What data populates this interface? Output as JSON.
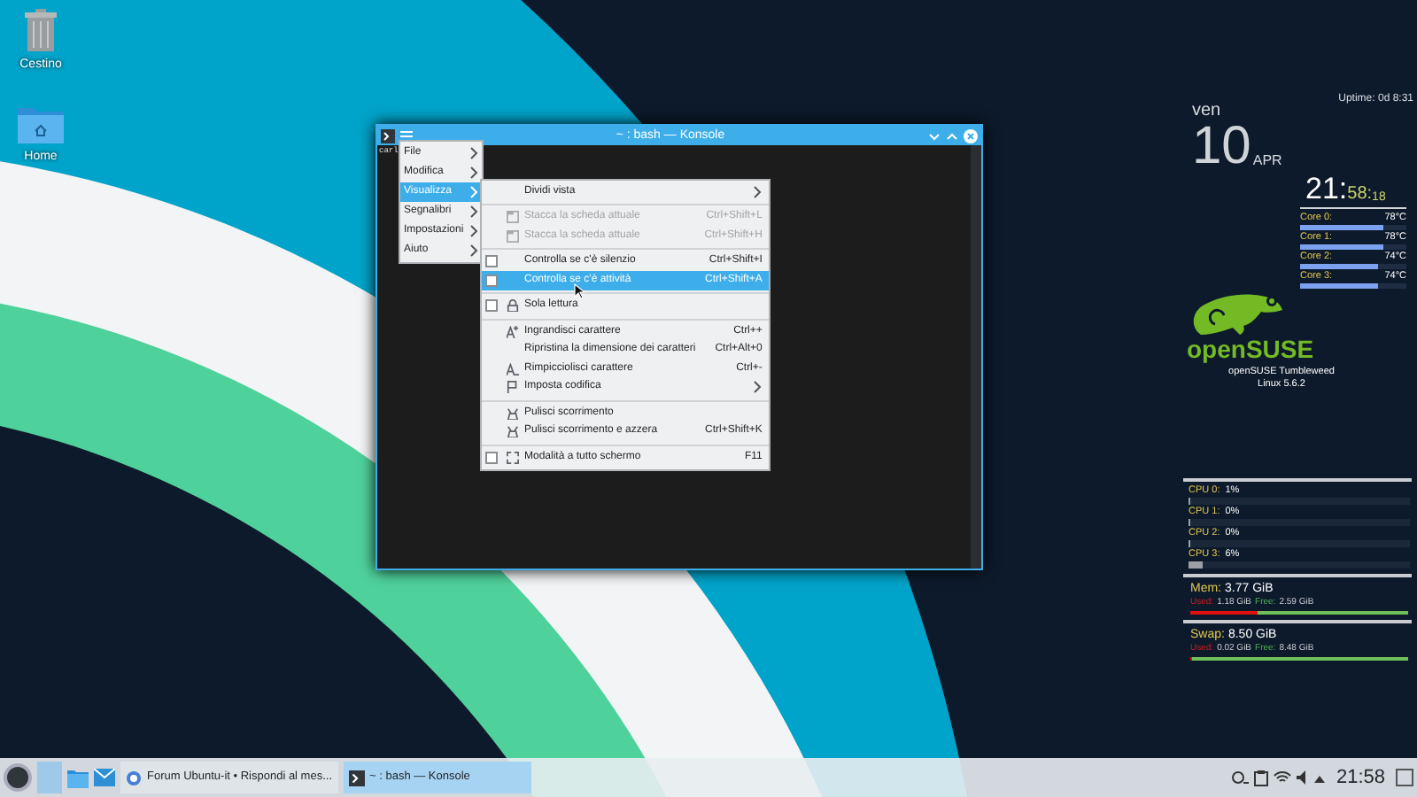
{
  "desktop_icons": [
    {
      "label": "Cestino",
      "kind": "trash"
    },
    {
      "label": "Home",
      "kind": "folder"
    }
  ],
  "konsole": {
    "title": "~ : bash — Konsole",
    "terminal_text": "carl",
    "menu": [
      {
        "label": "File",
        "selected": false
      },
      {
        "label": "Modifica",
        "selected": false
      },
      {
        "label": "Visualizza",
        "selected": true
      },
      {
        "label": "Segnalibri",
        "selected": false
      },
      {
        "label": "Impostazioni",
        "selected": false
      },
      {
        "label": "Aiuto",
        "selected": false
      }
    ],
    "submenu": [
      {
        "kind": "item",
        "label": "Dividi vista",
        "has_submenu": true,
        "disabled": false,
        "selected": false
      },
      {
        "kind": "separator"
      },
      {
        "kind": "item",
        "label": "Stacca la scheda attuale",
        "shortcut": "Ctrl+Shift+L",
        "disabled": true,
        "selected": false
      },
      {
        "kind": "item",
        "label": "Stacca la scheda attuale",
        "shortcut": "Ctrl+Shift+H",
        "disabled": true,
        "selected": false
      },
      {
        "kind": "separator"
      },
      {
        "kind": "check",
        "label": "Controlla se c'è silenzio",
        "shortcut": "Ctrl+Shift+I",
        "checked": false,
        "disabled": false,
        "selected": false
      },
      {
        "kind": "check",
        "label": "Controlla se c'è attività",
        "shortcut": "Ctrl+Shift+A",
        "checked": false,
        "disabled": false,
        "selected": true
      },
      {
        "kind": "separator"
      },
      {
        "kind": "check",
        "label": "Sola lettura",
        "checked": false,
        "disabled": false,
        "selected": false
      },
      {
        "kind": "separator"
      },
      {
        "kind": "item",
        "label": "Ingrandisci carattere",
        "shortcut": "Ctrl++",
        "disabled": false,
        "selected": false
      },
      {
        "kind": "item",
        "label": "Ripristina la dimensione dei caratteri",
        "shortcut": "Ctrl+Alt+0",
        "disabled": false,
        "selected": false
      },
      {
        "kind": "item",
        "label": "Rimpicciolisci carattere",
        "shortcut": "Ctrl+-",
        "disabled": false,
        "selected": false
      },
      {
        "kind": "item",
        "label": "Imposta codifica",
        "has_submenu": true,
        "disabled": false,
        "selected": false
      },
      {
        "kind": "separator"
      },
      {
        "kind": "item",
        "label": "Pulisci scorrimento",
        "disabled": false,
        "selected": false
      },
      {
        "kind": "item",
        "label": "Pulisci scorrimento e azzera",
        "shortcut": "Ctrl+Shift+K",
        "disabled": false,
        "selected": false
      },
      {
        "kind": "separator"
      },
      {
        "kind": "check",
        "label": "Modalità a tutto schermo",
        "shortcut": "F11",
        "checked": false,
        "disabled": false,
        "selected": false
      }
    ]
  },
  "conky": {
    "uptime": "Uptime: 0d 8:31",
    "weekday": "ven",
    "day": "10",
    "month": "APR",
    "hours": "21:",
    "minutes": "58:",
    "seconds": "18",
    "cores": [
      {
        "label": "Core 0:",
        "reading": "78°C",
        "level": 0.78
      },
      {
        "label": "Core 1:",
        "reading": "78°C",
        "level": 0.78
      },
      {
        "label": "Core 2:",
        "reading": "74°C",
        "level": 0.74
      },
      {
        "label": "Core 3:",
        "reading": "74°C",
        "level": 0.74
      }
    ],
    "logo_text": "openSUSE",
    "distro": "openSUSE Tumbleweed",
    "kernel": "Linux 5.6.2",
    "cpus": [
      {
        "label": "CPU 0:",
        "reading": "1%",
        "level": 0.01
      },
      {
        "label": "CPU 1:",
        "reading": "0%",
        "level": 0.0
      },
      {
        "label": "CPU 2:",
        "reading": "0%",
        "level": 0.0
      },
      {
        "label": "CPU 3:",
        "reading": "6%",
        "level": 0.06
      }
    ],
    "memory": [
      {
        "label": "Mem:",
        "total": "3.77 GiB",
        "used_label": "Used:",
        "used": "1.18 GiB",
        "free_label": "Free:",
        "free": "2.59 GiB",
        "level": 0.31
      },
      {
        "label": "Swap:",
        "total": "8.50 GiB",
        "used_label": "Used:",
        "used": "0.02 GiB",
        "free_label": "Free:",
        "free": "8.48 GiB",
        "level": 0.002
      }
    ]
  },
  "taskbar": {
    "tasks": [
      {
        "label": "Forum Ubuntu-it • Rispondi al mes...",
        "kind": "browser",
        "selected": false
      },
      {
        "label": "~ : bash — Konsole",
        "kind": "terminal",
        "selected": true
      }
    ],
    "clock": "21:58"
  }
}
